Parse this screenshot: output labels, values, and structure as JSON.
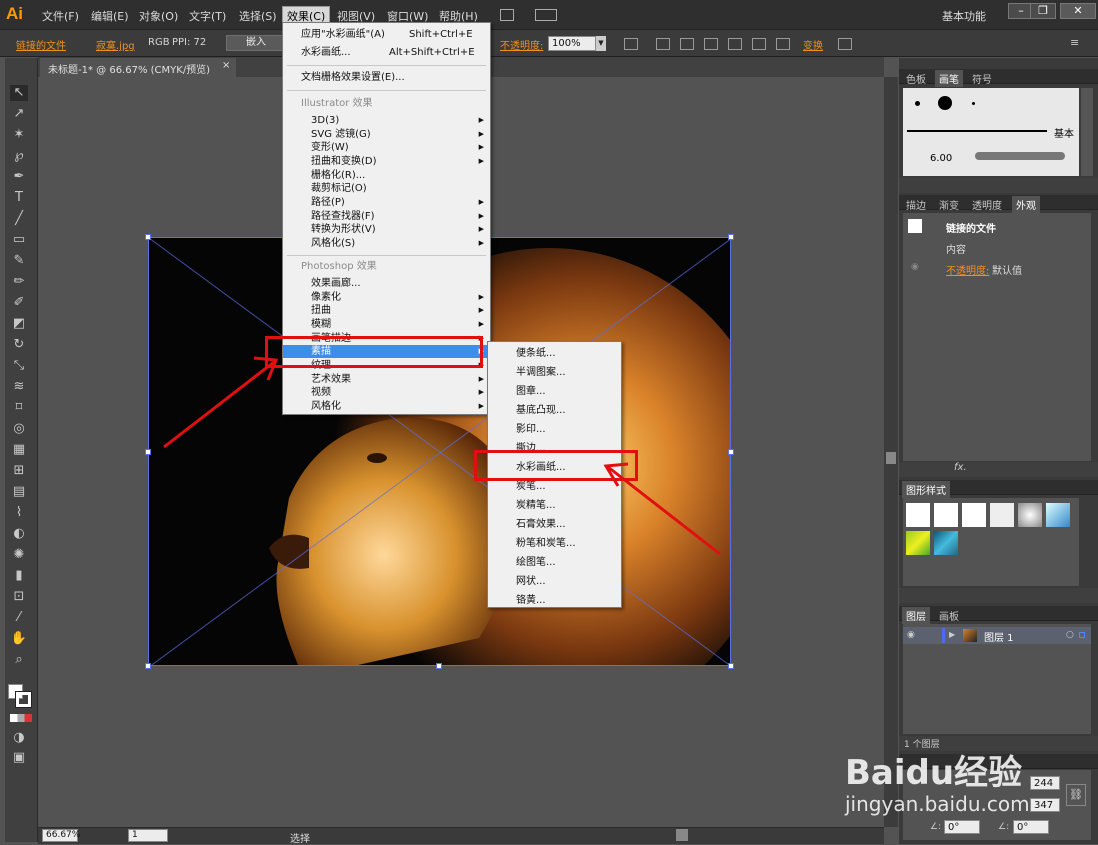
{
  "app": {
    "logo": "Ai",
    "workspace": "基本功能"
  },
  "menubar": [
    "文件(F)",
    "编辑(E)",
    "对象(O)",
    "文字(T)",
    "选择(S)",
    "效果(C)",
    "视图(V)",
    "窗口(W)",
    "帮助(H)"
  ],
  "control": {
    "linked_file": "链接的文件",
    "filename": "寂寞.jpg",
    "colormode": "RGB",
    "ppi": "PPI: 72",
    "embed": "嵌入",
    "opacity_label": "不透明度:",
    "opacity_value": "100%",
    "transform": "变换"
  },
  "document": {
    "tab": "未标题-1* @ 66.67% (CMYK/预览)",
    "close": "×"
  },
  "statusbar": {
    "zoom": "66.67%",
    "page": "1",
    "status": "选择"
  },
  "effect_menu": {
    "apply_last": "应用\"水彩画纸\"(A)",
    "apply_last_shortcut": "Shift+Ctrl+E",
    "last_effect": "水彩画纸...",
    "last_effect_shortcut": "Alt+Shift+Ctrl+E",
    "raster_settings": "文档栅格效果设置(E)...",
    "illustrator_header": "Illustrator 效果",
    "illustrator_items": [
      "3D(3)",
      "SVG 滤镜(G)",
      "变形(W)",
      "扭曲和变换(D)",
      "栅格化(R)...",
      "裁剪标记(O)",
      "路径(P)",
      "路径查找器(F)",
      "转换为形状(V)",
      "风格化(S)"
    ],
    "photoshop_header": "Photoshop 效果",
    "photoshop_items": [
      "效果画廊...",
      "像素化",
      "扭曲",
      "模糊",
      "画笔描边",
      "素描",
      "纹理",
      "艺术效果",
      "视频",
      "风格化"
    ]
  },
  "sketch_submenu": [
    "便条纸...",
    "半调图案...",
    "图章...",
    "基底凸现...",
    "影印...",
    "撕边...",
    "水彩画纸...",
    "炭笔...",
    "炭精笔...",
    "石膏效果...",
    "粉笔和炭笔...",
    "绘图笔...",
    "网状...",
    "铬黄..."
  ],
  "panels": {
    "swatch_tabs": [
      "色板",
      "画笔",
      "符号"
    ],
    "brush_basic": "基本",
    "brush_size": "6.00",
    "appearance_tabs": [
      "描边",
      "渐变",
      "透明度",
      "外观"
    ],
    "appearance_title": "链接的文件",
    "appearance_content": "内容",
    "appearance_opacity_label": "不透明度:",
    "appearance_opacity_value": "默认值",
    "graphic_styles_tab": "图形样式",
    "layers_tabs": [
      "图层",
      "画板"
    ],
    "layer_name": "图层 1",
    "layers_count": "1 个图层",
    "transform_values": {
      "w": "244",
      "h": "347",
      "angle1": "0°",
      "angle2": "0°"
    }
  },
  "watermark": {
    "brand": "Baidu经验",
    "url": "jingyan.baidu.com"
  },
  "colors": {
    "accent_orange": "#f0901d",
    "menu_highlight": "#3d8ee8",
    "annotation_red": "#e01010"
  }
}
